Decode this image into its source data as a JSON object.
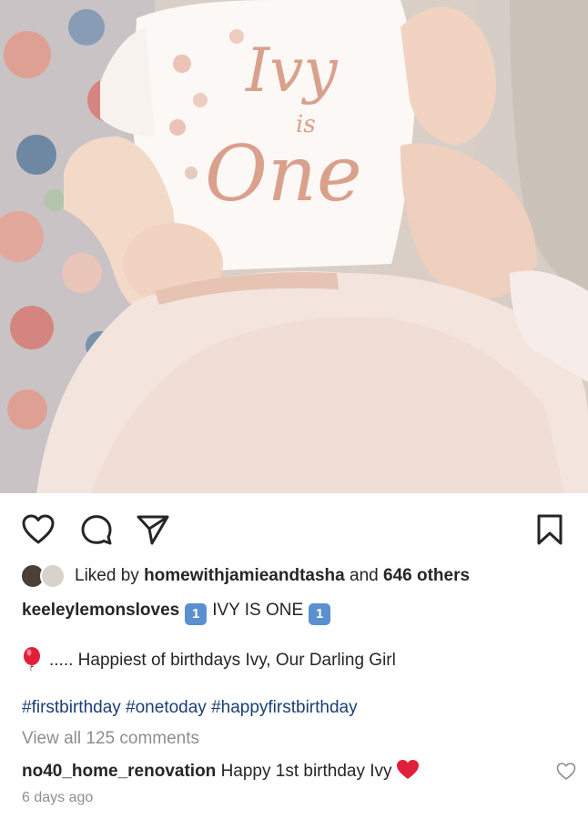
{
  "post": {
    "photo_icon": "baby-photo",
    "shirt_text_1": "Ivy",
    "shirt_text_2": "is",
    "shirt_text_3": "One"
  },
  "actions": {
    "like_icon": "heart-outline-icon",
    "comment_icon": "comment-bubble-icon",
    "share_icon": "paper-plane-icon",
    "save_icon": "bookmark-icon"
  },
  "likes": {
    "prefix": "Liked by",
    "user": "homewithjamieandtasha",
    "conjunction": "and",
    "others": "646 others"
  },
  "caption": {
    "username": "keeleylemonsloves",
    "badge": "1",
    "title": "IVY IS ONE",
    "message": "..... Happiest of birthdays Ivy, Our Darling Girl",
    "hashtags": "#firstbirthday #onetoday #happyfirstbirthday"
  },
  "comments": {
    "view_all": "View all 125 comments",
    "first": {
      "username": "no40_home_renovation",
      "text": "Happy 1st birthday Ivy"
    }
  },
  "timestamp": "6 days ago",
  "colors": {
    "text": "#262626",
    "muted": "#8e8e8e",
    "hashtag": "#1b3f73",
    "badge": "#5a8fd0",
    "heart": "#e0203a"
  }
}
